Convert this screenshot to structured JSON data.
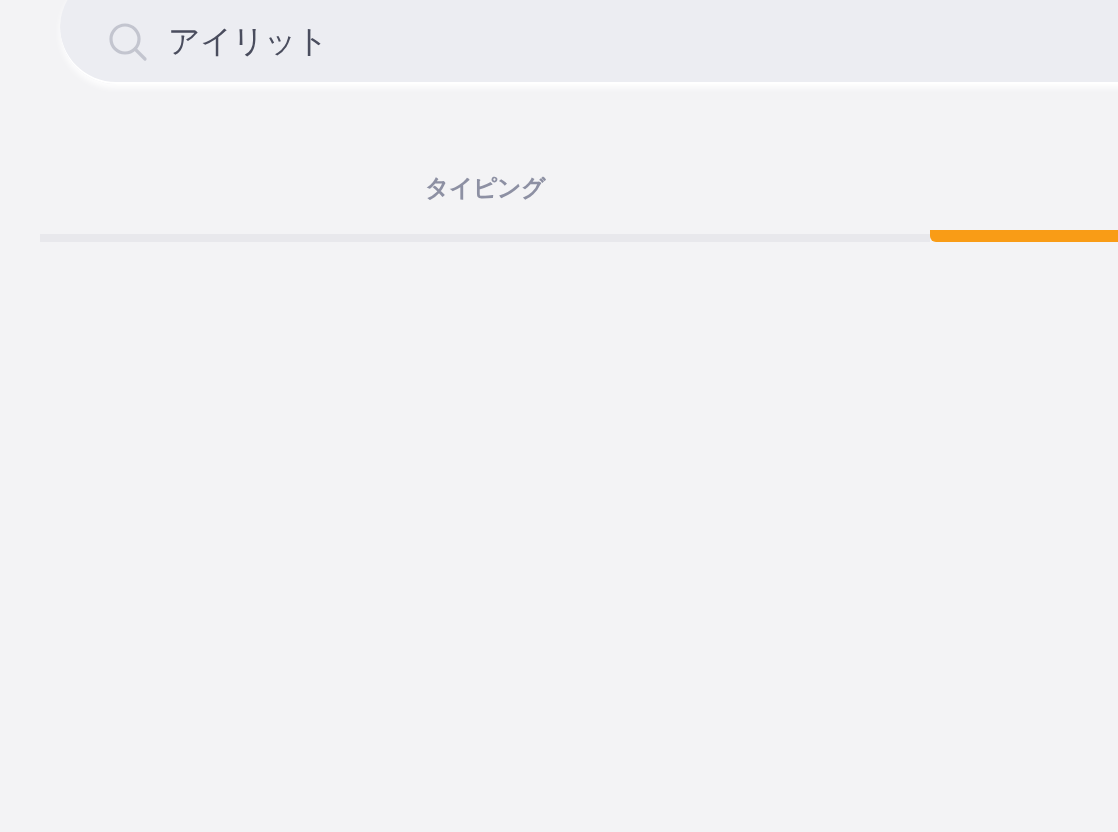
{
  "search": {
    "value": "アイリット"
  },
  "tabs": [
    {
      "label": "タイピング",
      "selected": false
    },
    {
      "selected": true
    }
  ]
}
